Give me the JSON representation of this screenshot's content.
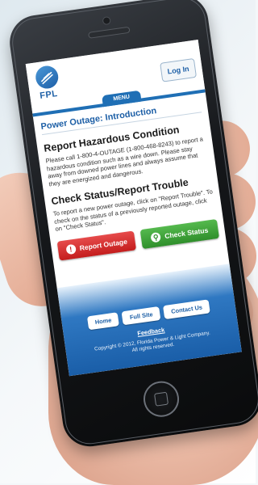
{
  "header": {
    "logo_text": "FPL",
    "login_label": "Log In",
    "menu_label": "MENU"
  },
  "page": {
    "title": "Power Outage: Introduction"
  },
  "hazard": {
    "heading": "Report Hazardous Condition",
    "text": "Please call 1-800-4-OUTAGE (1-800-468-8243) to report a hazardous condition such as a wire down. Please stay away from downed power lines and always assume that they are energized and dangerous."
  },
  "status": {
    "heading": "Check Status/Report Trouble",
    "text": "To report a new power outage, click on \"Report Trouble\". To check on the status of a previously reported outage, click on \"Check Status\"."
  },
  "buttons": {
    "report_outage": "Report Outage",
    "check_status": "Check Status"
  },
  "footer": {
    "links": [
      "Home",
      "Full Site",
      "Contact Us"
    ],
    "feedback": "Feedback",
    "copyright_line1": "Copyright © 2012, Florida Power & Light Company.",
    "copyright_line2": "All rights reserved."
  },
  "colors": {
    "brand_blue": "#1f6fb5",
    "report_red": "#c41d1d",
    "status_green": "#2f8f2b"
  },
  "icons": {
    "report": "exclamation-icon",
    "status": "magnifier-icon",
    "logo": "fpl-logo-icon"
  }
}
